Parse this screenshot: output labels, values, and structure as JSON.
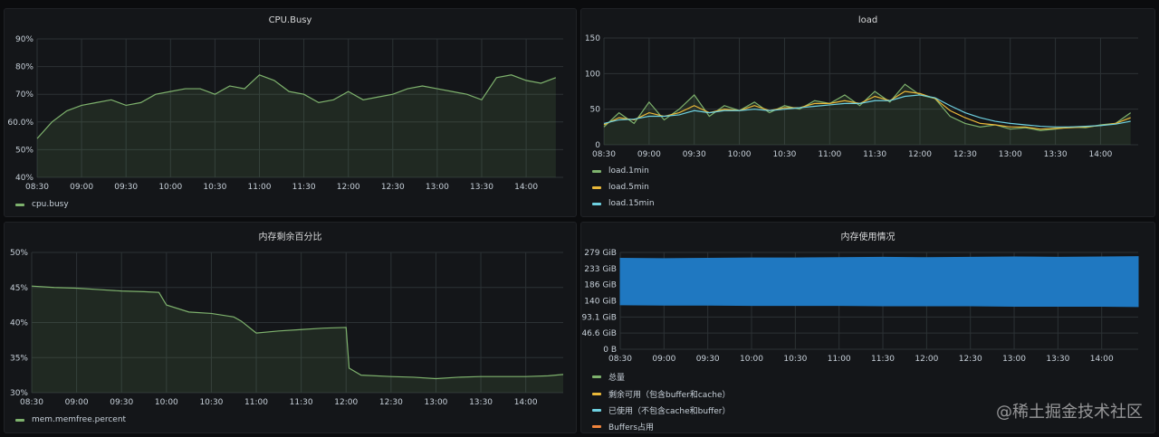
{
  "watermark": "@稀土掘金技术社区",
  "panels": {
    "cpu": {
      "title": "CPU.Busy",
      "legend": [
        {
          "label": "cpu.busy",
          "color": "#7eb26d"
        }
      ]
    },
    "load": {
      "title": "load",
      "legend": [
        {
          "label": "load.1min",
          "color": "#7eb26d"
        },
        {
          "label": "load.5min",
          "color": "#eab839"
        },
        {
          "label": "load.15min",
          "color": "#6ed0e0"
        }
      ]
    },
    "memfree": {
      "title": "内存剩余百分比",
      "legend": [
        {
          "label": "mem.memfree.percent",
          "color": "#7eb26d"
        }
      ]
    },
    "memuse": {
      "title": "内存使用情况",
      "legend": [
        {
          "label": "总量",
          "color": "#7eb26d"
        },
        {
          "label": "剩余可用（包含buffer和cache）",
          "color": "#eab839"
        },
        {
          "label": "已使用（不包含cache和buffer）",
          "color": "#6ed0e0"
        },
        {
          "label": "Buffers占用",
          "color": "#ef843c"
        }
      ]
    }
  },
  "chart_data": [
    {
      "type": "line",
      "title": "CPU.Busy",
      "x_ticks": [
        "08:30",
        "09:00",
        "09:30",
        "10:00",
        "10:30",
        "11:00",
        "11:30",
        "12:00",
        "12:30",
        "13:00",
        "13:30",
        "14:00"
      ],
      "y_ticks": [
        "90%",
        "80%",
        "70%",
        "60.0%",
        "50%",
        "40%"
      ],
      "ylim": [
        40,
        90
      ],
      "x": [
        "08:30",
        "08:40",
        "08:50",
        "09:00",
        "09:10",
        "09:20",
        "09:30",
        "09:40",
        "09:50",
        "10:00",
        "10:10",
        "10:20",
        "10:30",
        "10:40",
        "10:50",
        "11:00",
        "11:10",
        "11:20",
        "11:30",
        "11:40",
        "11:50",
        "12:00",
        "12:10",
        "12:20",
        "12:30",
        "12:40",
        "12:50",
        "13:00",
        "13:10",
        "13:20",
        "13:30",
        "13:40",
        "13:50",
        "14:00",
        "14:10",
        "14:20"
      ],
      "series": [
        {
          "name": "cpu.busy",
          "color": "#7eb26d",
          "values": [
            54,
            60,
            64,
            66,
            67,
            68,
            66,
            67,
            70,
            71,
            72,
            72,
            70,
            73,
            72,
            77,
            75,
            71,
            70,
            67,
            68,
            71,
            68,
            69,
            70,
            72,
            73,
            72,
            71,
            70,
            68,
            76,
            77,
            75,
            74,
            76
          ]
        }
      ]
    },
    {
      "type": "line",
      "title": "load",
      "x_ticks": [
        "08:30",
        "09:00",
        "09:30",
        "10:00",
        "10:30",
        "11:00",
        "11:30",
        "12:00",
        "12:30",
        "13:00",
        "13:30",
        "14:00"
      ],
      "y_ticks": [
        "150",
        "100",
        "50",
        "0"
      ],
      "ylim": [
        0,
        150
      ],
      "x": [
        "08:30",
        "08:40",
        "08:50",
        "09:00",
        "09:10",
        "09:20",
        "09:30",
        "09:40",
        "09:50",
        "10:00",
        "10:10",
        "10:20",
        "10:30",
        "10:40",
        "10:50",
        "11:00",
        "11:10",
        "11:20",
        "11:30",
        "11:40",
        "11:50",
        "12:00",
        "12:10",
        "12:20",
        "12:30",
        "12:40",
        "12:50",
        "13:00",
        "13:10",
        "13:20",
        "13:30",
        "13:40",
        "13:50",
        "14:00",
        "14:10",
        "14:20"
      ],
      "series": [
        {
          "name": "load.1min",
          "color": "#7eb26d",
          "values": [
            25,
            45,
            30,
            60,
            35,
            50,
            70,
            40,
            55,
            48,
            60,
            45,
            55,
            50,
            62,
            58,
            70,
            55,
            75,
            60,
            85,
            70,
            65,
            40,
            30,
            25,
            28,
            22,
            24,
            20,
            22,
            25,
            24,
            28,
            30,
            45
          ]
        },
        {
          "name": "load.5min",
          "color": "#eab839",
          "values": [
            28,
            38,
            35,
            45,
            40,
            45,
            55,
            45,
            50,
            48,
            55,
            48,
            52,
            52,
            58,
            58,
            62,
            58,
            68,
            62,
            75,
            72,
            65,
            48,
            38,
            30,
            28,
            25,
            25,
            22,
            23,
            24,
            25,
            27,
            30,
            38
          ]
        },
        {
          "name": "load.15min",
          "color": "#6ed0e0",
          "values": [
            30,
            35,
            36,
            40,
            40,
            42,
            48,
            45,
            48,
            48,
            50,
            48,
            50,
            52,
            54,
            56,
            58,
            58,
            62,
            62,
            68,
            70,
            66,
            55,
            45,
            38,
            33,
            30,
            28,
            26,
            25,
            25,
            26,
            27,
            29,
            33
          ]
        }
      ]
    },
    {
      "type": "line",
      "title": "内存剩余百分比",
      "x_ticks": [
        "08:30",
        "09:00",
        "09:30",
        "10:00",
        "10:30",
        "11:00",
        "11:30",
        "12:00",
        "12:30",
        "13:00",
        "13:30",
        "14:00"
      ],
      "y_ticks": [
        "50%",
        "45%",
        "40%",
        "35%",
        "30%"
      ],
      "ylim": [
        30,
        50
      ],
      "x": [
        "08:30",
        "08:45",
        "09:00",
        "09:15",
        "09:30",
        "09:45",
        "09:55",
        "10:00",
        "10:15",
        "10:30",
        "10:45",
        "10:50",
        "11:00",
        "11:15",
        "11:30",
        "11:45",
        "12:00",
        "12:02",
        "12:10",
        "12:30",
        "12:45",
        "13:00",
        "13:15",
        "13:30",
        "13:45",
        "14:00",
        "14:15",
        "14:25"
      ],
      "series": [
        {
          "name": "mem.memfree.percent",
          "color": "#7eb26d",
          "values": [
            45.2,
            45.0,
            44.9,
            44.7,
            44.5,
            44.4,
            44.3,
            42.5,
            41.5,
            41.3,
            40.8,
            40.2,
            38.5,
            38.8,
            39.0,
            39.2,
            39.3,
            33.5,
            32.5,
            32.3,
            32.2,
            32.0,
            32.2,
            32.3,
            32.3,
            32.3,
            32.4,
            32.6
          ]
        }
      ]
    },
    {
      "type": "area",
      "title": "内存使用情况",
      "x_ticks": [
        "08:30",
        "09:00",
        "09:30",
        "10:00",
        "10:30",
        "11:00",
        "11:30",
        "12:00",
        "12:30",
        "13:00",
        "13:30",
        "14:00"
      ],
      "y_ticks": [
        "279 GiB",
        "233 GiB",
        "186 GiB",
        "140 GiB",
        "93.1 GiB",
        "46.6 GiB",
        "0 B"
      ],
      "ylim": [
        0,
        279
      ],
      "x": [
        "08:30",
        "09:00",
        "09:30",
        "10:00",
        "10:30",
        "11:00",
        "11:30",
        "12:00",
        "12:30",
        "13:00",
        "13:30",
        "14:00",
        "14:25"
      ],
      "series": [
        {
          "name": "已使用（不包含cache和buffer）",
          "color": "#1f78c1",
          "upper": [
            262,
            261,
            262,
            263,
            263,
            264,
            265,
            264,
            265,
            266,
            265,
            266,
            267
          ],
          "lower": [
            128,
            127,
            127,
            126,
            126,
            126,
            125,
            125,
            125,
            124,
            124,
            124,
            123
          ]
        }
      ]
    }
  ]
}
